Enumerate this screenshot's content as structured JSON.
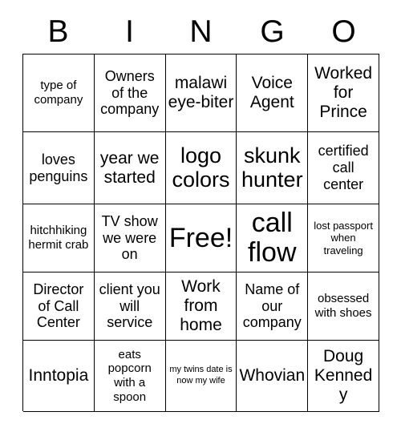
{
  "card": {
    "title": "Bingo Card",
    "columns": 5,
    "rows": 5,
    "border_color": "#000000",
    "background_color": "#ffffff",
    "text_color": "#000000"
  },
  "header": {
    "letters": [
      "B",
      "I",
      "N",
      "G",
      "O"
    ]
  },
  "grid": {
    "cells": [
      {
        "text": "type of company",
        "size": "sm",
        "free": false
      },
      {
        "text": "Owners of the company",
        "size": "md",
        "free": false
      },
      {
        "text": "malawi eye-biter",
        "size": "lg",
        "free": false
      },
      {
        "text": "Voice Agent",
        "size": "lg",
        "free": false
      },
      {
        "text": "Worked for Prince",
        "size": "lg",
        "free": false
      },
      {
        "text": "loves penguins",
        "size": "md",
        "free": false
      },
      {
        "text": "year we started",
        "size": "lg",
        "free": false
      },
      {
        "text": "logo colors",
        "size": "xl",
        "free": false
      },
      {
        "text": "skunk hunter",
        "size": "xl",
        "free": false
      },
      {
        "text": "certified call center",
        "size": "md",
        "free": false
      },
      {
        "text": "hitchhiking hermit crab",
        "size": "sm",
        "free": false
      },
      {
        "text": "TV show we were on",
        "size": "md",
        "free": false
      },
      {
        "text": "Free!",
        "size": "xxl",
        "free": true
      },
      {
        "text": "call flow",
        "size": "xxl",
        "free": false
      },
      {
        "text": "lost passport when traveling",
        "size": "xs",
        "free": false
      },
      {
        "text": "Director of Call Center",
        "size": "md",
        "free": false
      },
      {
        "text": "client you will service",
        "size": "md",
        "free": false
      },
      {
        "text": "Work from home",
        "size": "lg",
        "free": false
      },
      {
        "text": "Name of our company",
        "size": "md",
        "free": false
      },
      {
        "text": "obsessed with shoes",
        "size": "sm",
        "free": false
      },
      {
        "text": "Inntopia",
        "size": "lg",
        "free": false
      },
      {
        "text": "eats popcorn with a spoon",
        "size": "sm",
        "free": false
      },
      {
        "text": "my twins date is now my wife",
        "size": "xxs",
        "free": false
      },
      {
        "text": "Whovian",
        "size": "lg",
        "free": false
      },
      {
        "text": "Doug Kennedy",
        "size": "lg",
        "free": false
      }
    ]
  }
}
